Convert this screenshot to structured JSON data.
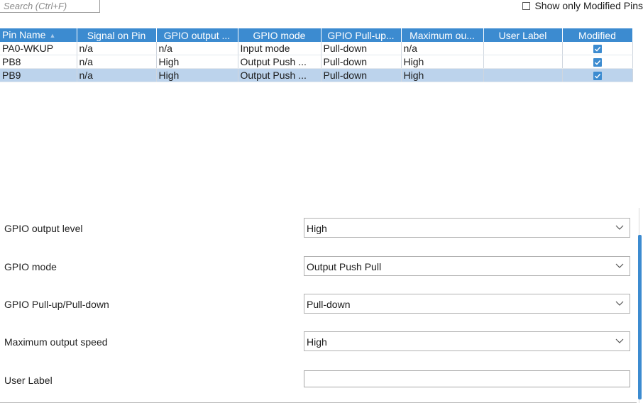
{
  "search": {
    "placeholder": "Search (Ctrl+F)"
  },
  "filter": {
    "show_only_modified_label": "Show only Modified Pins"
  },
  "table": {
    "columns": [
      "Pin Name",
      "Signal on Pin",
      "GPIO output ...",
      "GPIO mode",
      "GPIO Pull-up...",
      "Maximum ou...",
      "User Label",
      "Modified"
    ],
    "rows": [
      {
        "pin": "PA0-WKUP",
        "signal": "n/a",
        "output": "n/a",
        "mode": "Input mode",
        "pull": "Pull-down",
        "speed": "n/a",
        "label": "",
        "modified": true
      },
      {
        "pin": "PB8",
        "signal": "n/a",
        "output": "High",
        "mode": "Output Push ...",
        "pull": "Pull-down",
        "speed": "High",
        "label": "",
        "modified": true
      },
      {
        "pin": "PB9",
        "signal": "n/a",
        "output": "High",
        "mode": "Output Push ...",
        "pull": "Pull-down",
        "speed": "High",
        "label": "",
        "modified": true
      }
    ],
    "selected_row": 2
  },
  "config": {
    "output_level": {
      "label": "GPIO output level",
      "value": "High"
    },
    "mode": {
      "label": "GPIO mode",
      "value": "Output Push Pull"
    },
    "pull": {
      "label": "GPIO Pull-up/Pull-down",
      "value": "Pull-down"
    },
    "speed": {
      "label": "Maximum output speed",
      "value": "High"
    },
    "user_label": {
      "label": "User Label",
      "value": ""
    }
  },
  "colors": {
    "header": "#3c8bd0",
    "selection": "#bcd3ec",
    "check": "#3c8bd0"
  },
  "icons": {
    "sort": "sort-up-icon",
    "dropdown": "chevron-down-icon",
    "check": "check-icon"
  }
}
